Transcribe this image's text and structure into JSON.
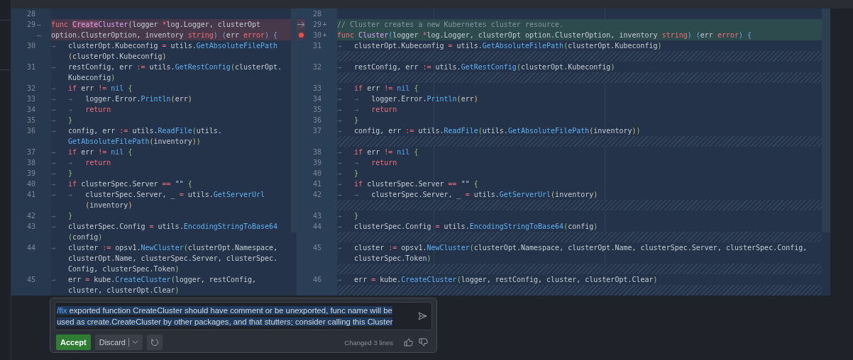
{
  "left_pane": {
    "lines": [
      {
        "number": "28",
        "deleted": false,
        "rows": [
          {
            "tokens": []
          }
        ]
      },
      {
        "number": "29",
        "deleted": true,
        "markers": [
          "—",
          "—"
        ],
        "rows": [
          {
            "tokens": [
              {
                "kind": "keyword",
                "text": "func "
              },
              {
                "kind": "changed",
                "text": "Create"
              },
              {
                "kind": "name",
                "text": "Cluster"
              },
              {
                "kind": "plain",
                "text": "(logger "
              },
              {
                "kind": "keyword",
                "text": "*"
              },
              {
                "kind": "plain",
                "text": "log.Logger, clusterOpt"
              }
            ]
          },
          {
            "tokens": [
              {
                "kind": "plain",
                "text": "option.ClusterOption, inventory "
              },
              {
                "kind": "keyword",
                "text": "string"
              },
              {
                "kind": "builtin",
                "text": ") "
              },
              {
                "kind": "builtin",
                "text": "("
              },
              {
                "kind": "plain",
                "text": "err "
              },
              {
                "kind": "keyword",
                "text": "error"
              },
              {
                "kind": "builtin",
                "text": ") "
              },
              {
                "kind": "builtin",
                "text": "{"
              }
            ]
          }
        ]
      },
      {
        "number": "30",
        "deleted": false,
        "rows": [
          {
            "tokens": [
              {
                "kind": "tab",
                "text": "→"
              },
              {
                "kind": "plain",
                "text": "   clusterOpt.Kubeconfig "
              },
              {
                "kind": "keyword",
                "text": "="
              },
              {
                "kind": "plain",
                "text": " utils."
              },
              {
                "kind": "call",
                "text": "GetAbsoluteFilePath"
              }
            ]
          },
          {
            "tokens": [
              {
                "kind": "paren",
                "text": "    ("
              },
              {
                "kind": "plain",
                "text": "clusterOpt.Kubeconfig"
              },
              {
                "kind": "paren",
                "text": ")"
              }
            ]
          }
        ]
      },
      {
        "number": "31",
        "deleted": false,
        "rows": [
          {
            "tokens": [
              {
                "kind": "tab",
                "text": "→"
              },
              {
                "kind": "plain",
                "text": "   restConfig, err "
              },
              {
                "kind": "keyword",
                "text": ":="
              },
              {
                "kind": "plain",
                "text": " utils."
              },
              {
                "kind": "call",
                "text": "GetRestConfig"
              },
              {
                "kind": "brace",
                "text": "("
              },
              {
                "kind": "plain",
                "text": "clusterOpt."
              }
            ]
          },
          {
            "tokens": [
              {
                "kind": "plain",
                "text": "    Kubeconfig"
              },
              {
                "kind": "brace",
                "text": ")"
              }
            ]
          }
        ]
      },
      {
        "number": "32",
        "deleted": false,
        "rows": [
          {
            "tokens": [
              {
                "kind": "tab",
                "text": "→   "
              },
              {
                "kind": "keyword",
                "text": "if"
              },
              {
                "kind": "plain",
                "text": " err "
              },
              {
                "kind": "keyword",
                "text": "!= "
              },
              {
                "kind": "builtin",
                "text": "nil "
              },
              {
                "kind": "brace",
                "text": "{"
              }
            ]
          }
        ]
      },
      {
        "number": "33",
        "deleted": false,
        "rows": [
          {
            "tokens": [
              {
                "kind": "tab",
                "text": "→   "
              },
              {
                "kind": "tab",
                "text": "→"
              },
              {
                "kind": "plain",
                "text": "   logger.Error."
              },
              {
                "kind": "call",
                "text": "Println"
              },
              {
                "kind": "paren",
                "text": "("
              },
              {
                "kind": "plain",
                "text": "err"
              },
              {
                "kind": "paren",
                "text": ")"
              }
            ]
          }
        ]
      },
      {
        "number": "34",
        "deleted": false,
        "rows": [
          {
            "tokens": [
              {
                "kind": "tab",
                "text": "→   "
              },
              {
                "kind": "tab",
                "text": "→   "
              },
              {
                "kind": "keyword",
                "text": "return"
              }
            ]
          }
        ]
      },
      {
        "number": "35",
        "deleted": false,
        "rows": [
          {
            "tokens": [
              {
                "kind": "tab",
                "text": "→   "
              },
              {
                "kind": "brace",
                "text": "}"
              }
            ]
          }
        ]
      },
      {
        "number": "36",
        "deleted": false,
        "rows": [
          {
            "tokens": [
              {
                "kind": "tab",
                "text": "→"
              },
              {
                "kind": "plain",
                "text": "   config, err "
              },
              {
                "kind": "keyword",
                "text": ":="
              },
              {
                "kind": "plain",
                "text": " utils."
              },
              {
                "kind": "call",
                "text": "ReadFile"
              },
              {
                "kind": "brace",
                "text": "("
              },
              {
                "kind": "plain",
                "text": "utils."
              }
            ]
          },
          {
            "tokens": [
              {
                "kind": "call",
                "text": "    GetAbsoluteFilePath"
              },
              {
                "kind": "paren",
                "text": "("
              },
              {
                "kind": "plain",
                "text": "inventory"
              },
              {
                "kind": "paren",
                "text": ")"
              },
              {
                "kind": "brace",
                "text": ")"
              }
            ]
          }
        ]
      },
      {
        "number": "37",
        "deleted": false,
        "rows": [
          {
            "tokens": [
              {
                "kind": "tab",
                "text": "→   "
              },
              {
                "kind": "keyword",
                "text": "if"
              },
              {
                "kind": "plain",
                "text": " err "
              },
              {
                "kind": "keyword",
                "text": "!= "
              },
              {
                "kind": "builtin",
                "text": "nil "
              },
              {
                "kind": "brace",
                "text": "{"
              }
            ]
          }
        ]
      },
      {
        "number": "38",
        "deleted": false,
        "rows": [
          {
            "tokens": [
              {
                "kind": "tab",
                "text": "→   "
              },
              {
                "kind": "tab",
                "text": "→   "
              },
              {
                "kind": "keyword",
                "text": "return"
              }
            ]
          }
        ]
      },
      {
        "number": "39",
        "deleted": false,
        "rows": [
          {
            "tokens": [
              {
                "kind": "tab",
                "text": "→   "
              },
              {
                "kind": "brace",
                "text": "}"
              }
            ]
          }
        ]
      },
      {
        "number": "40",
        "deleted": false,
        "rows": [
          {
            "tokens": [
              {
                "kind": "tab",
                "text": "→   "
              },
              {
                "kind": "keyword",
                "text": "if"
              },
              {
                "kind": "plain",
                "text": " clusterSpec.Server "
              },
              {
                "kind": "keyword",
                "text": "=="
              },
              {
                "kind": "plain",
                "text": " \"\" "
              },
              {
                "kind": "brace",
                "text": "{"
              }
            ]
          }
        ]
      },
      {
        "number": "41",
        "deleted": false,
        "rows": [
          {
            "tokens": [
              {
                "kind": "tab",
                "text": "→   "
              },
              {
                "kind": "tab",
                "text": "→"
              },
              {
                "kind": "plain",
                "text": "   clusterSpec.Server, _ "
              },
              {
                "kind": "keyword",
                "text": "="
              },
              {
                "kind": "plain",
                "text": " utils."
              },
              {
                "kind": "call",
                "text": "GetServerUrl"
              }
            ]
          },
          {
            "tokens": [
              {
                "kind": "paren",
                "text": "        ("
              },
              {
                "kind": "plain",
                "text": "inventory"
              },
              {
                "kind": "paren",
                "text": ")"
              }
            ]
          }
        ]
      },
      {
        "number": "42",
        "deleted": false,
        "rows": [
          {
            "tokens": [
              {
                "kind": "tab",
                "text": "→   "
              },
              {
                "kind": "brace",
                "text": "}"
              }
            ]
          }
        ]
      },
      {
        "number": "43",
        "deleted": false,
        "rows": [
          {
            "tokens": [
              {
                "kind": "tab",
                "text": "→"
              },
              {
                "kind": "plain",
                "text": "   clusterSpec.Config "
              },
              {
                "kind": "keyword",
                "text": "="
              },
              {
                "kind": "plain",
                "text": " utils."
              },
              {
                "kind": "call",
                "text": "EncodingStringToBase64"
              }
            ]
          },
          {
            "tokens": [
              {
                "kind": "brace",
                "text": "    ("
              },
              {
                "kind": "plain",
                "text": "config"
              },
              {
                "kind": "brace",
                "text": ")"
              }
            ]
          }
        ]
      },
      {
        "number": "44",
        "deleted": false,
        "rows": [
          {
            "tokens": [
              {
                "kind": "tab",
                "text": "→"
              },
              {
                "kind": "plain",
                "text": "   cluster "
              },
              {
                "kind": "keyword",
                "text": ":="
              },
              {
                "kind": "plain",
                "text": " opsv1."
              },
              {
                "kind": "call",
                "text": "NewCluster"
              },
              {
                "kind": "brace",
                "text": "("
              },
              {
                "kind": "plain",
                "text": "clusterOpt.Namespace,"
              }
            ]
          },
          {
            "tokens": [
              {
                "kind": "plain",
                "text": "    clusterOpt.Name, clusterSpec.Server, clusterSpec."
              }
            ]
          },
          {
            "tokens": [
              {
                "kind": "plain",
                "text": "    Config, clusterSpec.Token"
              },
              {
                "kind": "brace",
                "text": ")"
              }
            ]
          }
        ]
      },
      {
        "number": "45",
        "deleted": false,
        "rows": [
          {
            "tokens": [
              {
                "kind": "tab",
                "text": "→"
              },
              {
                "kind": "plain",
                "text": "   err "
              },
              {
                "kind": "keyword",
                "text": "="
              },
              {
                "kind": "plain",
                "text": " kube."
              },
              {
                "kind": "call",
                "text": "CreateCluster"
              },
              {
                "kind": "brace",
                "text": "("
              },
              {
                "kind": "plain",
                "text": "logger, restConfig,"
              }
            ]
          },
          {
            "tokens": [
              {
                "kind": "plain",
                "text": "    cluster, clusterOpt.Clear"
              },
              {
                "kind": "brace",
                "text": ")"
              }
            ]
          }
        ]
      }
    ]
  },
  "right_pane": {
    "lines": [
      {
        "kind": "code",
        "number": "28",
        "added": false,
        "current": false,
        "breakpoint": false,
        "rows": [
          {
            "tokens": []
          }
        ]
      },
      {
        "kind": "code",
        "number": "29",
        "added": true,
        "current": true,
        "breakpoint": false,
        "markers": [
          "+"
        ],
        "rows": [
          {
            "tokens": [
              {
                "kind": "comment",
                "text": "// Cluster creates a new Kubernetes cluster resource."
              }
            ]
          }
        ]
      },
      {
        "kind": "code",
        "number": "30",
        "added": true,
        "current": false,
        "breakpoint": true,
        "markers": [
          "+"
        ],
        "rows": [
          {
            "tokens": [
              {
                "kind": "keyword",
                "text": "func "
              },
              {
                "kind": "name",
                "text": "Cluster"
              },
              {
                "kind": "builtin",
                "text": "("
              },
              {
                "kind": "plain",
                "text": "logger "
              },
              {
                "kind": "keyword",
                "text": "*"
              },
              {
                "kind": "plain",
                "text": "log.Logger, clusterOpt option.ClusterOption, inventory "
              },
              {
                "kind": "keyword",
                "text": "string"
              },
              {
                "kind": "builtin",
                "text": ") "
              },
              {
                "kind": "builtin",
                "text": "("
              },
              {
                "kind": "plain",
                "text": "err "
              },
              {
                "kind": "keyword",
                "text": "error"
              },
              {
                "kind": "builtin",
                "text": ") "
              },
              {
                "kind": "builtin",
                "text": "{"
              }
            ]
          }
        ]
      },
      {
        "kind": "code",
        "number": "31",
        "added": false,
        "current": false,
        "breakpoint": false,
        "rows": [
          {
            "tokens": [
              {
                "kind": "tab",
                "text": "→"
              },
              {
                "kind": "plain",
                "text": "   clusterOpt.Kubeconfig "
              },
              {
                "kind": "keyword",
                "text": "="
              },
              {
                "kind": "plain",
                "text": " utils."
              },
              {
                "kind": "call",
                "text": "GetAbsoluteFilePath"
              },
              {
                "kind": "brace",
                "text": "("
              },
              {
                "kind": "plain",
                "text": "clusterOpt.Kubeconfig"
              },
              {
                "kind": "brace",
                "text": ")"
              }
            ]
          }
        ]
      },
      {
        "kind": "filler"
      },
      {
        "kind": "code",
        "number": "32",
        "added": false,
        "current": false,
        "breakpoint": false,
        "rows": [
          {
            "tokens": [
              {
                "kind": "tab",
                "text": "→"
              },
              {
                "kind": "plain",
                "text": "   restConfig, err "
              },
              {
                "kind": "keyword",
                "text": ":="
              },
              {
                "kind": "plain",
                "text": " utils."
              },
              {
                "kind": "call",
                "text": "GetRestConfig"
              },
              {
                "kind": "brace",
                "text": "("
              },
              {
                "kind": "plain",
                "text": "clusterOpt.Kubeconfig"
              },
              {
                "kind": "brace",
                "text": ")"
              }
            ]
          }
        ]
      },
      {
        "kind": "filler"
      },
      {
        "kind": "code",
        "number": "33",
        "added": false,
        "current": false,
        "breakpoint": false,
        "rows": [
          {
            "tokens": [
              {
                "kind": "tab",
                "text": "→   "
              },
              {
                "kind": "keyword",
                "text": "if"
              },
              {
                "kind": "plain",
                "text": " err "
              },
              {
                "kind": "keyword",
                "text": "!= "
              },
              {
                "kind": "builtin",
                "text": "nil "
              },
              {
                "kind": "brace",
                "text": "{"
              }
            ]
          }
        ]
      },
      {
        "kind": "code",
        "number": "34",
        "added": false,
        "current": false,
        "breakpoint": false,
        "rows": [
          {
            "tokens": [
              {
                "kind": "tab",
                "text": "→   "
              },
              {
                "kind": "tab",
                "text": "→"
              },
              {
                "kind": "plain",
                "text": "   logger.Error."
              },
              {
                "kind": "call",
                "text": "Println"
              },
              {
                "kind": "paren",
                "text": "("
              },
              {
                "kind": "plain",
                "text": "err"
              },
              {
                "kind": "paren",
                "text": ")"
              }
            ]
          }
        ]
      },
      {
        "kind": "code",
        "number": "35",
        "added": false,
        "current": false,
        "breakpoint": false,
        "rows": [
          {
            "tokens": [
              {
                "kind": "tab",
                "text": "→   "
              },
              {
                "kind": "tab",
                "text": "→   "
              },
              {
                "kind": "keyword",
                "text": "return"
              }
            ]
          }
        ]
      },
      {
        "kind": "code",
        "number": "36",
        "added": false,
        "current": false,
        "breakpoint": false,
        "rows": [
          {
            "tokens": [
              {
                "kind": "tab",
                "text": "→   "
              },
              {
                "kind": "brace",
                "text": "}"
              }
            ]
          }
        ]
      },
      {
        "kind": "code",
        "number": "37",
        "added": false,
        "current": false,
        "breakpoint": false,
        "rows": [
          {
            "tokens": [
              {
                "kind": "tab",
                "text": "→"
              },
              {
                "kind": "plain",
                "text": "   config, err "
              },
              {
                "kind": "keyword",
                "text": ":="
              },
              {
                "kind": "plain",
                "text": " utils."
              },
              {
                "kind": "call",
                "text": "ReadFile"
              },
              {
                "kind": "brace",
                "text": "("
              },
              {
                "kind": "plain",
                "text": "utils."
              },
              {
                "kind": "call",
                "text": "GetAbsoluteFilePath"
              },
              {
                "kind": "paren",
                "text": "("
              },
              {
                "kind": "plain",
                "text": "inventory"
              },
              {
                "kind": "paren",
                "text": ")"
              },
              {
                "kind": "brace",
                "text": ")"
              }
            ]
          }
        ]
      },
      {
        "kind": "filler"
      },
      {
        "kind": "code",
        "number": "38",
        "added": false,
        "current": false,
        "breakpoint": false,
        "rows": [
          {
            "tokens": [
              {
                "kind": "tab",
                "text": "→   "
              },
              {
                "kind": "keyword",
                "text": "if"
              },
              {
                "kind": "plain",
                "text": " err "
              },
              {
                "kind": "keyword",
                "text": "!= "
              },
              {
                "kind": "builtin",
                "text": "nil "
              },
              {
                "kind": "brace",
                "text": "{"
              }
            ]
          }
        ]
      },
      {
        "kind": "code",
        "number": "39",
        "added": false,
        "current": false,
        "breakpoint": false,
        "rows": [
          {
            "tokens": [
              {
                "kind": "tab",
                "text": "→   "
              },
              {
                "kind": "tab",
                "text": "→   "
              },
              {
                "kind": "keyword",
                "text": "return"
              }
            ]
          }
        ]
      },
      {
        "kind": "code",
        "number": "40",
        "added": false,
        "current": false,
        "breakpoint": false,
        "rows": [
          {
            "tokens": [
              {
                "kind": "tab",
                "text": "→   "
              },
              {
                "kind": "brace",
                "text": "}"
              }
            ]
          }
        ]
      },
      {
        "kind": "code",
        "number": "41",
        "added": false,
        "current": false,
        "breakpoint": false,
        "rows": [
          {
            "tokens": [
              {
                "kind": "tab",
                "text": "→   "
              },
              {
                "kind": "keyword",
                "text": "if"
              },
              {
                "kind": "plain",
                "text": " clusterSpec.Server "
              },
              {
                "kind": "keyword",
                "text": "=="
              },
              {
                "kind": "plain",
                "text": " \"\" "
              },
              {
                "kind": "brace",
                "text": "{"
              }
            ]
          }
        ]
      },
      {
        "kind": "code",
        "number": "42",
        "added": false,
        "current": false,
        "breakpoint": false,
        "rows": [
          {
            "tokens": [
              {
                "kind": "tab",
                "text": "→   "
              },
              {
                "kind": "tab",
                "text": "→"
              },
              {
                "kind": "plain",
                "text": "   clusterSpec.Server, _ "
              },
              {
                "kind": "keyword",
                "text": "="
              },
              {
                "kind": "plain",
                "text": " utils."
              },
              {
                "kind": "call",
                "text": "GetServerUrl"
              },
              {
                "kind": "paren",
                "text": "("
              },
              {
                "kind": "plain",
                "text": "inventory"
              },
              {
                "kind": "paren",
                "text": ")"
              }
            ]
          }
        ]
      },
      {
        "kind": "filler"
      },
      {
        "kind": "code",
        "number": "43",
        "added": false,
        "current": false,
        "breakpoint": false,
        "rows": [
          {
            "tokens": [
              {
                "kind": "tab",
                "text": "→   "
              },
              {
                "kind": "brace",
                "text": "}"
              }
            ]
          }
        ]
      },
      {
        "kind": "code",
        "number": "44",
        "added": false,
        "current": false,
        "breakpoint": false,
        "rows": [
          {
            "tokens": [
              {
                "kind": "tab",
                "text": "→"
              },
              {
                "kind": "plain",
                "text": "   clusterSpec.Config "
              },
              {
                "kind": "keyword",
                "text": "="
              },
              {
                "kind": "plain",
                "text": " utils."
              },
              {
                "kind": "call",
                "text": "EncodingStringToBase64"
              },
              {
                "kind": "brace",
                "text": "("
              },
              {
                "kind": "plain",
                "text": "config"
              },
              {
                "kind": "brace",
                "text": ")"
              }
            ]
          }
        ]
      },
      {
        "kind": "filler"
      },
      {
        "kind": "code",
        "number": "45",
        "added": false,
        "current": false,
        "breakpoint": false,
        "rows": [
          {
            "tokens": [
              {
                "kind": "tab",
                "text": "→"
              },
              {
                "kind": "plain",
                "text": "   cluster "
              },
              {
                "kind": "keyword",
                "text": ":="
              },
              {
                "kind": "plain",
                "text": " opsv1."
              },
              {
                "kind": "call",
                "text": "NewCluster"
              },
              {
                "kind": "brace",
                "text": "("
              },
              {
                "kind": "plain",
                "text": "clusterOpt.Namespace, clusterOpt.Name, clusterSpec.Server, clusterSpec.Config,"
              }
            ]
          },
          {
            "tokens": [
              {
                "kind": "plain",
                "text": "    clusterSpec.Token"
              },
              {
                "kind": "brace",
                "text": ")"
              }
            ]
          }
        ]
      },
      {
        "kind": "filler"
      },
      {
        "kind": "code",
        "number": "46",
        "added": false,
        "current": false,
        "breakpoint": false,
        "rows": [
          {
            "tokens": [
              {
                "kind": "tab",
                "text": "→"
              },
              {
                "kind": "plain",
                "text": "   err "
              },
              {
                "kind": "keyword",
                "text": "="
              },
              {
                "kind": "plain",
                "text": " kube."
              },
              {
                "kind": "call",
                "text": "CreateCluster"
              },
              {
                "kind": "brace",
                "text": "("
              },
              {
                "kind": "plain",
                "text": "logger, restConfig, cluster, clusterOpt.Clear"
              },
              {
                "kind": "brace",
                "text": ")"
              }
            ]
          }
        ]
      },
      {
        "kind": "filler"
      }
    ]
  },
  "fix_popup": {
    "command": "/fix",
    "prompt": "exported function CreateCluster should have comment or be unexported, func name will be used as create.CreateCluster by other packages, and that stutters; consider calling this Cluster",
    "buttons": [
      {
        "kind": "primary",
        "label": "Accept"
      },
      {
        "kind": "split",
        "label": "Discard"
      },
      {
        "kind": "icon"
      }
    ],
    "status": "Changed 3 lines"
  }
}
